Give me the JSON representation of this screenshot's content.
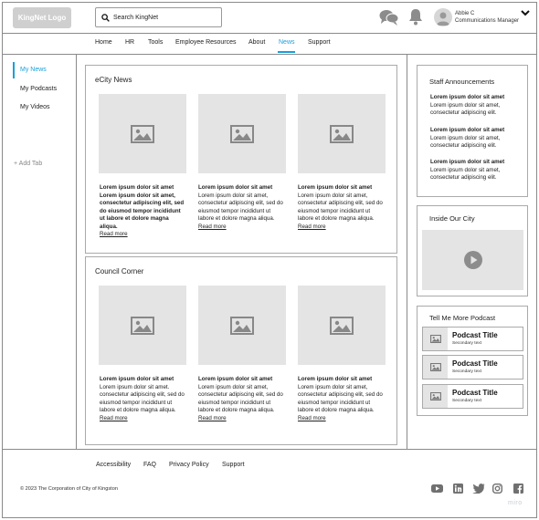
{
  "header": {
    "logo_text": "KingNet Logo",
    "search_placeholder": "Search KingNet",
    "user_name": "Abbie C",
    "user_role": "Communications Manager"
  },
  "nav": {
    "items": [
      "Home",
      "HR",
      "Tools",
      "Employee Resources",
      "About",
      "News",
      "Support"
    ],
    "active": "News"
  },
  "sidebar": {
    "items": [
      "My News",
      "My Podcasts",
      "My Videos"
    ],
    "active": "My News",
    "add_tab": "+ Add Tab"
  },
  "ecity_news": {
    "title": "eCity News",
    "articles": [
      {
        "bold": "Lorem ipsum dolor sit amet Lorem ipsum dolor sit amet, consectetur adipiscing elit, sed do eiusmod tempor incididunt ut labore et dolore magna aliqua.",
        "body": "",
        "link": "Read more"
      },
      {
        "bold": "Lorem ipsum dolor sit amet",
        "body": "Lorem ipsum dolor sit amet, consectetur adipiscing elit, sed do eiusmod tempor incididunt ut labore et dolore magna aliqua.",
        "link": "Read more"
      },
      {
        "bold": "Lorem ipsum dolor sit amet",
        "body": "Lorem ipsum dolor sit amet, consectetur adipiscing elit, sed do eiusmod tempor incididunt ut labore et dolore magna aliqua.",
        "link": "Read more"
      }
    ]
  },
  "council_corner": {
    "title": "Council Corner",
    "articles": [
      {
        "bold": "Lorem ipsum dolor sit amet",
        "body": "Lorem ipsum dolor sit amet. consectetur adipiscing elit, sed do eiusmod tempor incididunt ut labore et dolore magna aliqua.",
        "link": "Read more"
      },
      {
        "bold": "Lorem ipsum dolor sit amet",
        "body": "Lorem ipsum dolor sit amet, consectetur adipiscing elit, sed do eiusmod tempor incididunt ut labore et dolore magna aliqua.",
        "link": "Read more"
      },
      {
        "bold": "Lorem ipsum dolor sit amet",
        "body": "Lorem ipsum dolor sit amet, consectetur adipiscing elit, sed do eiusmod tempor incididunt ut labore et dolore magna aliqua.",
        "link": "Read more"
      }
    ]
  },
  "staff_announcements": {
    "title": "Staff Announcements",
    "items": [
      {
        "bold": "Lorem ipsum dolor sit amet",
        "body": "Lorem ipsum dolor sit amet, consectetur adipiscing elit."
      },
      {
        "bold": "Lorem ipsum dolor sit amet",
        "body": "Lorem ipsum dolor sit amet, consectetur adipiscing elit."
      },
      {
        "bold": "Lorem ipsum dolor sit amet",
        "body": "Lorem ipsum dolor sit amet, consectetur adipiscing elit."
      }
    ]
  },
  "inside_our_city": {
    "title": "Inside Our City"
  },
  "podcasts": {
    "title": "Tell Me More Podcast",
    "items": [
      {
        "title": "Podcast Title",
        "sub": "Secondary text"
      },
      {
        "title": "Podcast Title",
        "sub": "Secondary text"
      },
      {
        "title": "Podcast Title",
        "sub": "Secondary text"
      }
    ]
  },
  "footer": {
    "links": [
      "Accessibility",
      "FAQ",
      "Privacy Policy",
      "Support"
    ],
    "copyright": "© 2023 The Corporation of City of Kingston",
    "social_icons": [
      "youtube-icon",
      "linkedin-icon",
      "twitter-icon",
      "instagram-icon",
      "facebook-icon"
    ],
    "watermark": "miro"
  },
  "colors": {
    "accent": "#1a9fd9",
    "placeholder": "#e4e4e4",
    "border": "#aaaaaa"
  }
}
